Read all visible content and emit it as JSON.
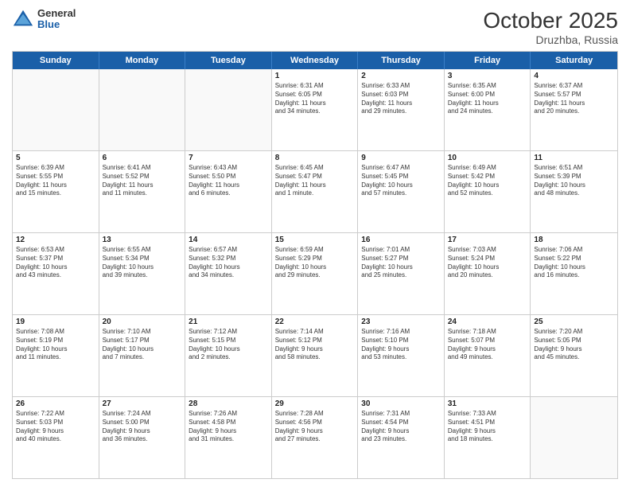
{
  "logo": {
    "general": "General",
    "blue": "Blue"
  },
  "title": "October 2025",
  "subtitle": "Druzhba, Russia",
  "days": [
    "Sunday",
    "Monday",
    "Tuesday",
    "Wednesday",
    "Thursday",
    "Friday",
    "Saturday"
  ],
  "weeks": [
    [
      {
        "num": "",
        "text": "",
        "empty": true
      },
      {
        "num": "",
        "text": "",
        "empty": true
      },
      {
        "num": "",
        "text": "",
        "empty": true
      },
      {
        "num": "1",
        "text": "Sunrise: 6:31 AM\nSunset: 6:05 PM\nDaylight: 11 hours\nand 34 minutes.",
        "empty": false
      },
      {
        "num": "2",
        "text": "Sunrise: 6:33 AM\nSunset: 6:03 PM\nDaylight: 11 hours\nand 29 minutes.",
        "empty": false
      },
      {
        "num": "3",
        "text": "Sunrise: 6:35 AM\nSunset: 6:00 PM\nDaylight: 11 hours\nand 24 minutes.",
        "empty": false
      },
      {
        "num": "4",
        "text": "Sunrise: 6:37 AM\nSunset: 5:57 PM\nDaylight: 11 hours\nand 20 minutes.",
        "empty": false
      }
    ],
    [
      {
        "num": "5",
        "text": "Sunrise: 6:39 AM\nSunset: 5:55 PM\nDaylight: 11 hours\nand 15 minutes.",
        "empty": false
      },
      {
        "num": "6",
        "text": "Sunrise: 6:41 AM\nSunset: 5:52 PM\nDaylight: 11 hours\nand 11 minutes.",
        "empty": false
      },
      {
        "num": "7",
        "text": "Sunrise: 6:43 AM\nSunset: 5:50 PM\nDaylight: 11 hours\nand 6 minutes.",
        "empty": false
      },
      {
        "num": "8",
        "text": "Sunrise: 6:45 AM\nSunset: 5:47 PM\nDaylight: 11 hours\nand 1 minute.",
        "empty": false
      },
      {
        "num": "9",
        "text": "Sunrise: 6:47 AM\nSunset: 5:45 PM\nDaylight: 10 hours\nand 57 minutes.",
        "empty": false
      },
      {
        "num": "10",
        "text": "Sunrise: 6:49 AM\nSunset: 5:42 PM\nDaylight: 10 hours\nand 52 minutes.",
        "empty": false
      },
      {
        "num": "11",
        "text": "Sunrise: 6:51 AM\nSunset: 5:39 PM\nDaylight: 10 hours\nand 48 minutes.",
        "empty": false
      }
    ],
    [
      {
        "num": "12",
        "text": "Sunrise: 6:53 AM\nSunset: 5:37 PM\nDaylight: 10 hours\nand 43 minutes.",
        "empty": false
      },
      {
        "num": "13",
        "text": "Sunrise: 6:55 AM\nSunset: 5:34 PM\nDaylight: 10 hours\nand 39 minutes.",
        "empty": false
      },
      {
        "num": "14",
        "text": "Sunrise: 6:57 AM\nSunset: 5:32 PM\nDaylight: 10 hours\nand 34 minutes.",
        "empty": false
      },
      {
        "num": "15",
        "text": "Sunrise: 6:59 AM\nSunset: 5:29 PM\nDaylight: 10 hours\nand 29 minutes.",
        "empty": false
      },
      {
        "num": "16",
        "text": "Sunrise: 7:01 AM\nSunset: 5:27 PM\nDaylight: 10 hours\nand 25 minutes.",
        "empty": false
      },
      {
        "num": "17",
        "text": "Sunrise: 7:03 AM\nSunset: 5:24 PM\nDaylight: 10 hours\nand 20 minutes.",
        "empty": false
      },
      {
        "num": "18",
        "text": "Sunrise: 7:06 AM\nSunset: 5:22 PM\nDaylight: 10 hours\nand 16 minutes.",
        "empty": false
      }
    ],
    [
      {
        "num": "19",
        "text": "Sunrise: 7:08 AM\nSunset: 5:19 PM\nDaylight: 10 hours\nand 11 minutes.",
        "empty": false
      },
      {
        "num": "20",
        "text": "Sunrise: 7:10 AM\nSunset: 5:17 PM\nDaylight: 10 hours\nand 7 minutes.",
        "empty": false
      },
      {
        "num": "21",
        "text": "Sunrise: 7:12 AM\nSunset: 5:15 PM\nDaylight: 10 hours\nand 2 minutes.",
        "empty": false
      },
      {
        "num": "22",
        "text": "Sunrise: 7:14 AM\nSunset: 5:12 PM\nDaylight: 9 hours\nand 58 minutes.",
        "empty": false
      },
      {
        "num": "23",
        "text": "Sunrise: 7:16 AM\nSunset: 5:10 PM\nDaylight: 9 hours\nand 53 minutes.",
        "empty": false
      },
      {
        "num": "24",
        "text": "Sunrise: 7:18 AM\nSunset: 5:07 PM\nDaylight: 9 hours\nand 49 minutes.",
        "empty": false
      },
      {
        "num": "25",
        "text": "Sunrise: 7:20 AM\nSunset: 5:05 PM\nDaylight: 9 hours\nand 45 minutes.",
        "empty": false
      }
    ],
    [
      {
        "num": "26",
        "text": "Sunrise: 7:22 AM\nSunset: 5:03 PM\nDaylight: 9 hours\nand 40 minutes.",
        "empty": false
      },
      {
        "num": "27",
        "text": "Sunrise: 7:24 AM\nSunset: 5:00 PM\nDaylight: 9 hours\nand 36 minutes.",
        "empty": false
      },
      {
        "num": "28",
        "text": "Sunrise: 7:26 AM\nSunset: 4:58 PM\nDaylight: 9 hours\nand 31 minutes.",
        "empty": false
      },
      {
        "num": "29",
        "text": "Sunrise: 7:28 AM\nSunset: 4:56 PM\nDaylight: 9 hours\nand 27 minutes.",
        "empty": false
      },
      {
        "num": "30",
        "text": "Sunrise: 7:31 AM\nSunset: 4:54 PM\nDaylight: 9 hours\nand 23 minutes.",
        "empty": false
      },
      {
        "num": "31",
        "text": "Sunrise: 7:33 AM\nSunset: 4:51 PM\nDaylight: 9 hours\nand 18 minutes.",
        "empty": false
      },
      {
        "num": "",
        "text": "",
        "empty": true
      }
    ]
  ]
}
